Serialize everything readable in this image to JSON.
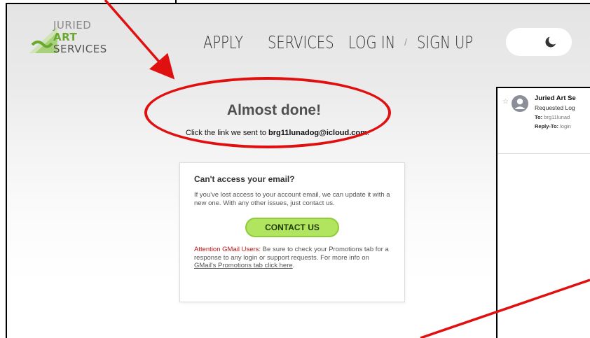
{
  "logo": {
    "line1": "JURIED",
    "line2": "ART",
    "line3": "SERVICES"
  },
  "nav": {
    "apply": "APPLY",
    "services": "SERVICES",
    "login": "LOG IN",
    "separator": "/",
    "signup": "SIGN UP"
  },
  "theme_toggle": {
    "icon": "moon-icon"
  },
  "main": {
    "title": "Almost done!",
    "subtitle_prefix": "Click the link we sent to ",
    "email": "brg11lunadog@icloud.com",
    "subtitle_suffix": "."
  },
  "card": {
    "heading": "Can't access your email?",
    "body": "If you've lost access to your account email, we can update it with a new one. With any other issues, just contact us.",
    "button": "CONTACT US",
    "notice_warn": "Attention GMail Users:",
    "notice_body": " Be sure to check your Promotions tab for a response to any login or support requests. For more info on ",
    "notice_link": "GMail's Promotions tab click here",
    "notice_end": "."
  },
  "email_preview": {
    "sender": "Juried Art Se",
    "subject": "Requested Log",
    "to_label": "To:",
    "to_value": " brg11lunad",
    "reply_label": "Reply-To:",
    "reply_value": " login"
  },
  "colors": {
    "annotation_red": "#e11010",
    "button_green": "#b2e55f",
    "brand_green": "#6aa930",
    "warning_red": "#c21616"
  }
}
